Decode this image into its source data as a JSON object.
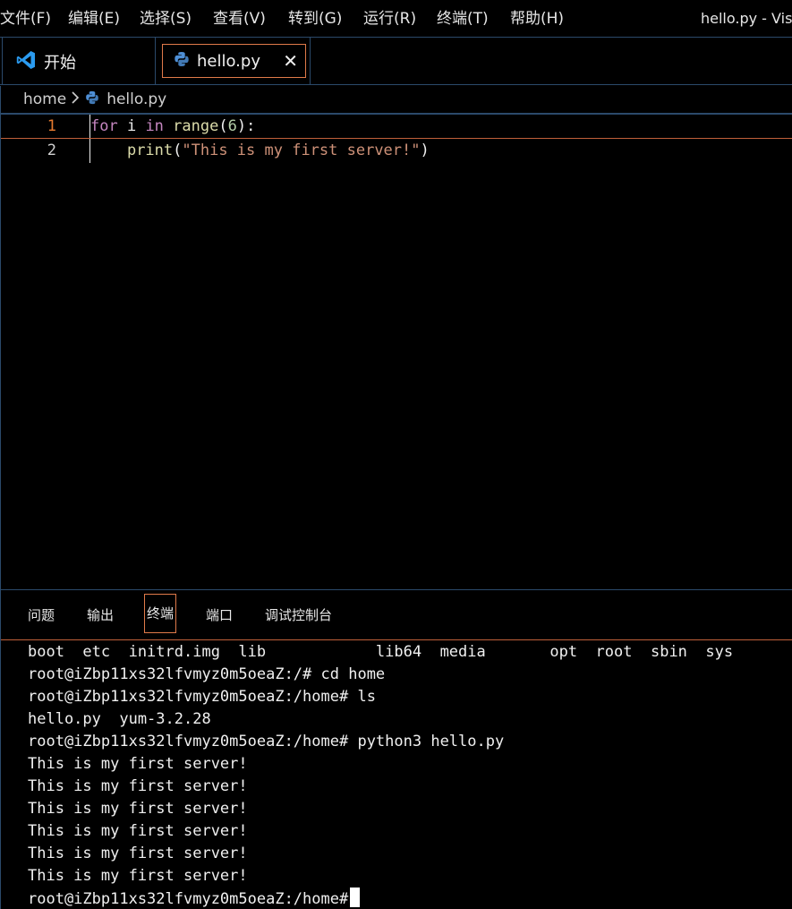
{
  "menu": {
    "items": [
      "文件(F)",
      "编辑(E)",
      "选择(S)",
      "查看(V)",
      "转到(G)",
      "运行(R)",
      "终端(T)",
      "帮助(H)"
    ],
    "window_title": "hello.py - Visu"
  },
  "tabs": {
    "start_label": "开始",
    "file_label": "hello.py",
    "close_glyph": "✕"
  },
  "breadcrumb": {
    "folder": "home",
    "file": "hello.py"
  },
  "editor": {
    "line_numbers": [
      "1",
      "2"
    ],
    "line1": {
      "kw_for": "for",
      "var": " i ",
      "kw_in": "in",
      "sp": " ",
      "fn": "range",
      "open": "(",
      "num": "6",
      "close": "):"
    },
    "line2": {
      "indent": "    ",
      "fn": "print",
      "open": "(",
      "str": "\"This is my first server!\"",
      "close": ")"
    }
  },
  "panel": {
    "tabs": [
      "问题",
      "输出",
      "终端",
      "端口",
      "调试控制台"
    ],
    "active_tab": "终端"
  },
  "terminal": {
    "lines": [
      "boot  etc  initrd.img  lib            lib64  media       opt  root  sbin  sys",
      "root@iZbp11xs32lfvmyz0m5oeaZ:/# cd home",
      "root@iZbp11xs32lfvmyz0m5oeaZ:/home# ls",
      "hello.py  yum-3.2.28",
      "root@iZbp11xs32lfvmyz0m5oeaZ:/home# python3 hello.py",
      "This is my first server!",
      "This is my first server!",
      "This is my first server!",
      "This is my first server!",
      "This is my first server!",
      "This is my first server!"
    ],
    "prompt": "root@iZbp11xs32lfvmyz0m5oeaZ:/home#"
  },
  "colors": {
    "accent_border": "#e07a4a",
    "divider": "#2b4a6b",
    "keyword": "#c586c0",
    "function": "#dcdcaa",
    "number": "#b5cea8",
    "string": "#ce9178"
  },
  "icons": [
    "vscode-logo-icon",
    "python-file-icon",
    "close-icon",
    "chevron-right-icon"
  ]
}
